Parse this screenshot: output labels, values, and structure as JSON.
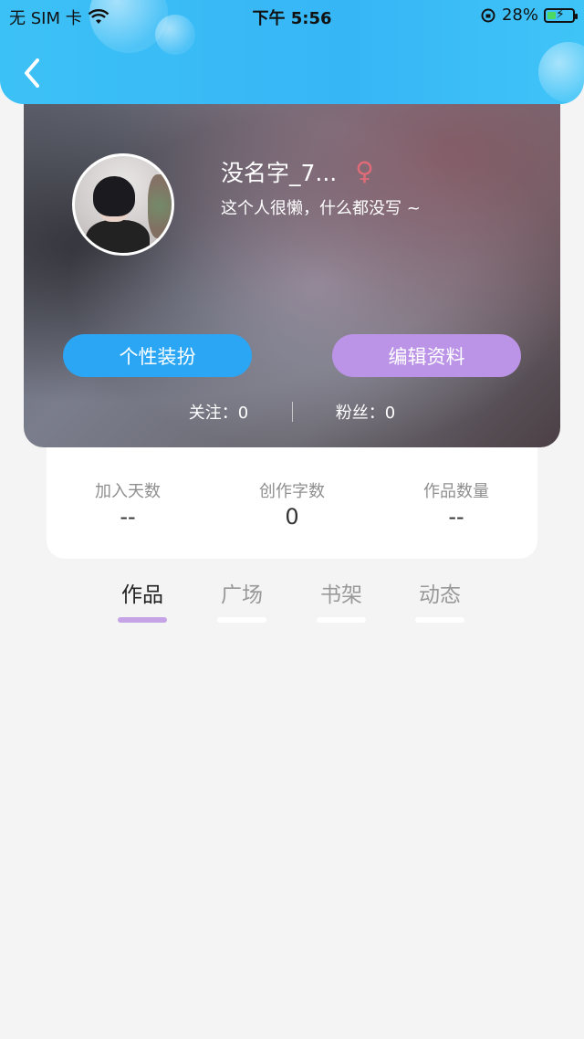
{
  "status_bar": {
    "carrier": "无 SIM 卡",
    "time": "下午 5:56",
    "battery": "28%",
    "battery_level": 0.28
  },
  "profile": {
    "username": "没名字_7...",
    "gender_symbol": "♀",
    "bio": "这个人很懒，什么都没写 ~"
  },
  "buttons": {
    "dress_up": "个性装扮",
    "edit_profile": "编辑资料"
  },
  "follow": {
    "following_label": "关注：",
    "following_count": "0",
    "fans_label": "粉丝：",
    "fans_count": "0"
  },
  "stats": [
    {
      "label": "加入天数",
      "value": "--"
    },
    {
      "label": "创作字数",
      "value": "0"
    },
    {
      "label": "作品数量",
      "value": "--"
    }
  ],
  "tabs": [
    {
      "label": "作品",
      "active": true
    },
    {
      "label": "广场",
      "active": false
    },
    {
      "label": "书架",
      "active": false
    },
    {
      "label": "动态",
      "active": false
    }
  ],
  "colors": {
    "header_blue": "#37b6f6",
    "dress_button": "#2aa6f5",
    "edit_button": "#bc94e7",
    "active_tab_indicator": "#c4a3e6",
    "gender_female": "#e06b78"
  }
}
